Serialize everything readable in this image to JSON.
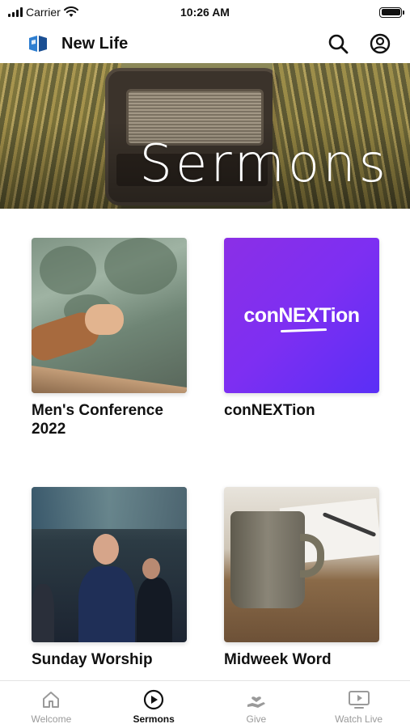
{
  "status_bar": {
    "carrier": "Carrier",
    "time": "10:26 AM",
    "icons": [
      "signal-icon",
      "wifi-icon",
      "battery-icon"
    ]
  },
  "header": {
    "app_title": "New Life",
    "logo_icon": "new-life-logo",
    "actions": [
      "search-icon",
      "profile-icon"
    ]
  },
  "hero": {
    "title": "Sermons"
  },
  "sermon_series": [
    {
      "title": "Men's Conference 2022"
    },
    {
      "title": "conNEXTion",
      "thumbnail_text": "conNEXTion"
    },
    {
      "title": "Sunday Worship"
    },
    {
      "title": "Midweek Word"
    }
  ],
  "tab_bar": {
    "tabs": [
      {
        "label": "Welcome",
        "icon": "home-icon"
      },
      {
        "label": "Sermons",
        "icon": "play-circle-icon",
        "active": true
      },
      {
        "label": "Give",
        "icon": "give-hand-heart-icon"
      },
      {
        "label": "Watch Live",
        "icon": "tv-play-icon"
      }
    ]
  },
  "colors": {
    "accent_purple": "#7d2ff2",
    "text": "#111111",
    "inactive_tab": "#9a9a9a"
  }
}
